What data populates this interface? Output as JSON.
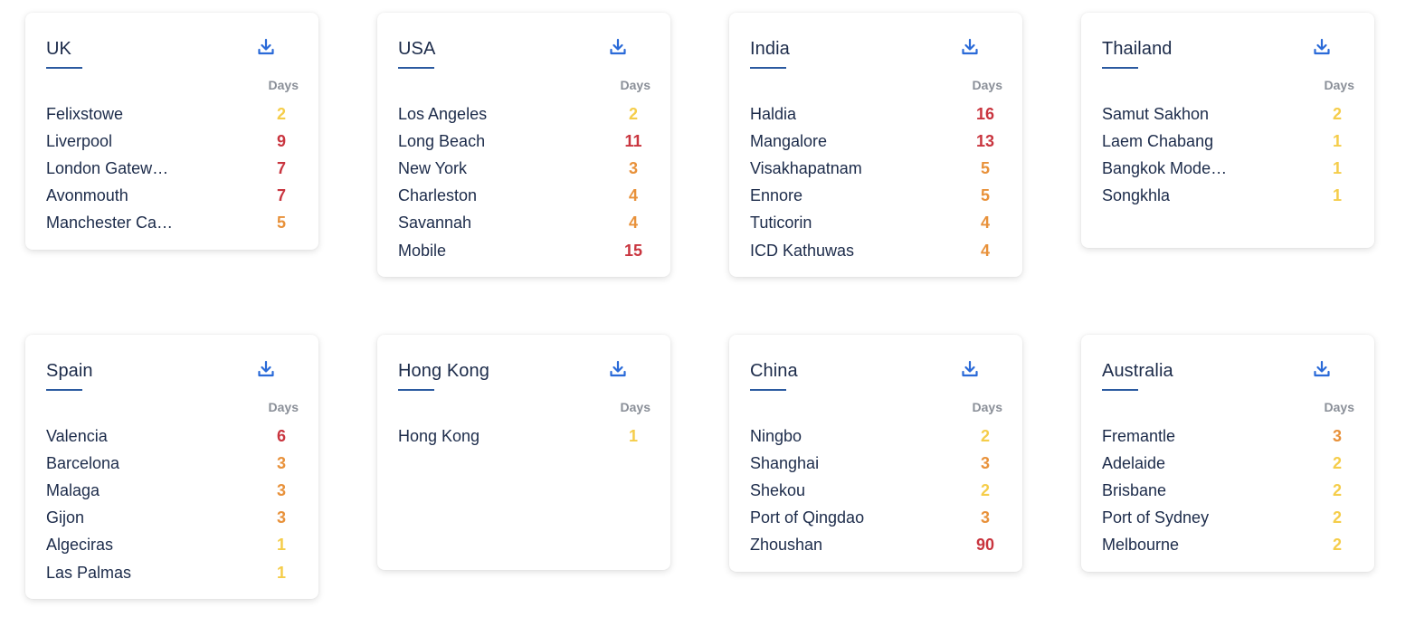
{
  "column_header": "Days",
  "colors": {
    "low": "#f5cd4a",
    "medium": "#e8913a",
    "high": "#c9353f",
    "title": "#1c2b4a",
    "accent": "#2b5aa0",
    "icon": "#2a6ad8"
  },
  "cards": [
    {
      "country": "UK",
      "icon": "download-icon",
      "ports": [
        {
          "name": "Felixstowe",
          "days": "2",
          "level": "low"
        },
        {
          "name": "Liverpool",
          "days": "9",
          "level": "high"
        },
        {
          "name": "London Gatew…",
          "days": "7",
          "level": "high"
        },
        {
          "name": "Avonmouth",
          "days": "7",
          "level": "high"
        },
        {
          "name": "Manchester Ca…",
          "days": "5",
          "level": "medium"
        }
      ]
    },
    {
      "country": "USA",
      "icon": "download-icon",
      "ports": [
        {
          "name": "Los Angeles",
          "days": "2",
          "level": "low"
        },
        {
          "name": "Long Beach",
          "days": "11",
          "level": "high"
        },
        {
          "name": "New York",
          "days": "3",
          "level": "medium"
        },
        {
          "name": "Charleston",
          "days": "4",
          "level": "medium"
        },
        {
          "name": "Savannah",
          "days": "4",
          "level": "medium"
        },
        {
          "name": "Mobile",
          "days": "15",
          "level": "high"
        }
      ]
    },
    {
      "country": "India",
      "icon": "download-icon",
      "ports": [
        {
          "name": "Haldia",
          "days": "16",
          "level": "high"
        },
        {
          "name": "Mangalore",
          "days": "13",
          "level": "high"
        },
        {
          "name": "Visakhapatnam",
          "days": "5",
          "level": "medium"
        },
        {
          "name": "Ennore",
          "days": "5",
          "level": "medium"
        },
        {
          "name": "Tuticorin",
          "days": "4",
          "level": "medium"
        },
        {
          "name": "ICD Kathuwas",
          "days": "4",
          "level": "medium"
        }
      ]
    },
    {
      "country": "Thailand",
      "icon": "download-icon",
      "ports": [
        {
          "name": "Samut Sakhon",
          "days": "2",
          "level": "low"
        },
        {
          "name": "Laem Chabang",
          "days": "1",
          "level": "low"
        },
        {
          "name": "Bangkok Mode…",
          "days": "1",
          "level": "low"
        },
        {
          "name": "Songkhla",
          "days": "1",
          "level": "low"
        }
      ]
    },
    {
      "country": "Spain",
      "icon": "download-icon",
      "ports": [
        {
          "name": "Valencia",
          "days": "6",
          "level": "high"
        },
        {
          "name": "Barcelona",
          "days": "3",
          "level": "medium"
        },
        {
          "name": "Malaga",
          "days": "3",
          "level": "medium"
        },
        {
          "name": "Gijon",
          "days": "3",
          "level": "medium"
        },
        {
          "name": "Algeciras",
          "days": "1",
          "level": "low"
        },
        {
          "name": "Las Palmas",
          "days": "1",
          "level": "low"
        }
      ]
    },
    {
      "country": "Hong Kong",
      "icon": "download-icon",
      "ports": [
        {
          "name": "Hong Kong",
          "days": "1",
          "level": "low"
        }
      ]
    },
    {
      "country": "China",
      "icon": "download-icon",
      "ports": [
        {
          "name": "Ningbo",
          "days": "2",
          "level": "low"
        },
        {
          "name": "Shanghai",
          "days": "3",
          "level": "medium"
        },
        {
          "name": "Shekou",
          "days": "2",
          "level": "low"
        },
        {
          "name": "Port of Qingdao",
          "days": "3",
          "level": "medium"
        },
        {
          "name": "Zhoushan",
          "days": "90",
          "level": "high"
        }
      ]
    },
    {
      "country": "Australia",
      "icon": "download-icon",
      "ports": [
        {
          "name": "Fremantle",
          "days": "3",
          "level": "medium"
        },
        {
          "name": "Adelaide",
          "days": "2",
          "level": "low"
        },
        {
          "name": "Brisbane",
          "days": "2",
          "level": "low"
        },
        {
          "name": "Port of Sydney",
          "days": "2",
          "level": "low"
        },
        {
          "name": "Melbourne",
          "days": "2",
          "level": "low"
        }
      ]
    }
  ]
}
